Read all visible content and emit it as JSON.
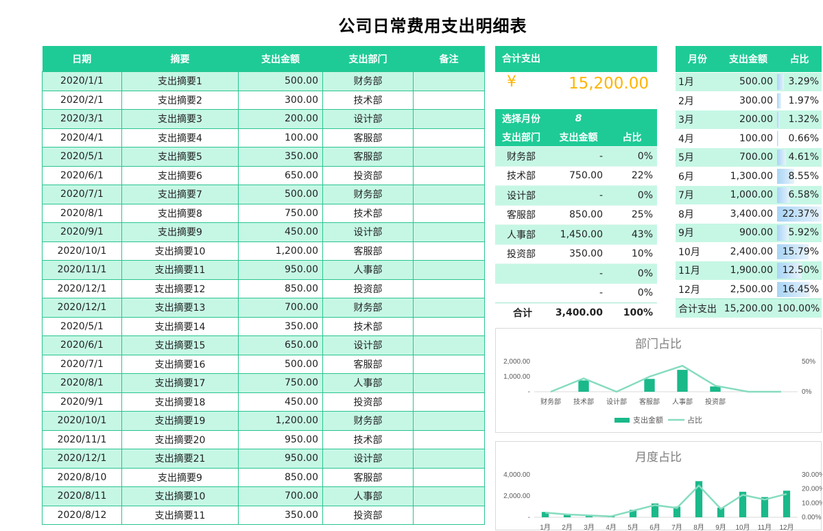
{
  "title": "公司日常费用支出明细表",
  "colors": {
    "accent": "#1ecb96",
    "stripe": "#c6f7e5",
    "total": "#ffb400"
  },
  "main_table": {
    "headers": [
      "日期",
      "摘要",
      "支出金额",
      "支出部门",
      "备注"
    ],
    "rows": [
      [
        "2020/1/1",
        "支出摘要1",
        "500.00",
        "财务部",
        ""
      ],
      [
        "2020/2/1",
        "支出摘要2",
        "300.00",
        "技术部",
        ""
      ],
      [
        "2020/3/1",
        "支出摘要3",
        "200.00",
        "设计部",
        ""
      ],
      [
        "2020/4/1",
        "支出摘要4",
        "100.00",
        "客服部",
        ""
      ],
      [
        "2020/5/1",
        "支出摘要5",
        "350.00",
        "客服部",
        ""
      ],
      [
        "2020/6/1",
        "支出摘要6",
        "650.00",
        "投资部",
        ""
      ],
      [
        "2020/7/1",
        "支出摘要7",
        "500.00",
        "财务部",
        ""
      ],
      [
        "2020/8/1",
        "支出摘要8",
        "750.00",
        "技术部",
        ""
      ],
      [
        "2020/9/1",
        "支出摘要9",
        "450.00",
        "设计部",
        ""
      ],
      [
        "2020/10/1",
        "支出摘要10",
        "1,200.00",
        "客服部",
        ""
      ],
      [
        "2020/11/1",
        "支出摘要11",
        "950.00",
        "人事部",
        ""
      ],
      [
        "2020/12/1",
        "支出摘要12",
        "850.00",
        "投资部",
        ""
      ],
      [
        "2020/12/1",
        "支出摘要13",
        "700.00",
        "财务部",
        ""
      ],
      [
        "2020/5/1",
        "支出摘要14",
        "350.00",
        "技术部",
        ""
      ],
      [
        "2020/6/1",
        "支出摘要15",
        "650.00",
        "设计部",
        ""
      ],
      [
        "2020/7/1",
        "支出摘要16",
        "500.00",
        "客服部",
        ""
      ],
      [
        "2020/8/1",
        "支出摘要17",
        "750.00",
        "人事部",
        ""
      ],
      [
        "2020/9/1",
        "支出摘要18",
        "450.00",
        "投资部",
        ""
      ],
      [
        "2020/10/1",
        "支出摘要19",
        "1,200.00",
        "财务部",
        ""
      ],
      [
        "2020/11/1",
        "支出摘要20",
        "950.00",
        "技术部",
        ""
      ],
      [
        "2020/12/1",
        "支出摘要21",
        "950.00",
        "设计部",
        ""
      ],
      [
        "2020/8/10",
        "支出摘要9",
        "850.00",
        "客服部",
        ""
      ],
      [
        "2020/8/11",
        "支出摘要10",
        "700.00",
        "人事部",
        ""
      ],
      [
        "2020/8/12",
        "支出摘要11",
        "350.00",
        "投资部",
        ""
      ]
    ]
  },
  "total": {
    "label": "合计支出",
    "currency": "¥",
    "value": "15,200.00"
  },
  "dept_table": {
    "select_label": "选择月份",
    "selected_month": "8",
    "headers": [
      "支出部门",
      "支出金额",
      "占比"
    ],
    "rows": [
      [
        "财务部",
        "-",
        "0%"
      ],
      [
        "技术部",
        "750.00",
        "22%"
      ],
      [
        "设计部",
        "-",
        "0%"
      ],
      [
        "客服部",
        "850.00",
        "25%"
      ],
      [
        "人事部",
        "1,450.00",
        "43%"
      ],
      [
        "投资部",
        "350.00",
        "10%"
      ],
      [
        "",
        "-",
        "0%"
      ],
      [
        "",
        "-",
        "0%"
      ]
    ],
    "footer": [
      "合计",
      "3,400.00",
      "100%"
    ]
  },
  "monthly_table": {
    "headers": [
      "月份",
      "支出金额",
      "占比"
    ],
    "rows": [
      [
        "1月",
        "500.00",
        "3.29%"
      ],
      [
        "2月",
        "300.00",
        "1.97%"
      ],
      [
        "3月",
        "200.00",
        "1.32%"
      ],
      [
        "4月",
        "100.00",
        "0.66%"
      ],
      [
        "5月",
        "700.00",
        "4.61%"
      ],
      [
        "6月",
        "1,300.00",
        "8.55%"
      ],
      [
        "7月",
        "1,000.00",
        "6.58%"
      ],
      [
        "8月",
        "3,400.00",
        "22.37%"
      ],
      [
        "9月",
        "900.00",
        "5.92%"
      ],
      [
        "10月",
        "2,400.00",
        "15.79%"
      ],
      [
        "11月",
        "1,900.00",
        "12.50%"
      ],
      [
        "12月",
        "2,500.00",
        "16.45%"
      ]
    ],
    "bar_fractions": [
      0.0329,
      0.0197,
      0.0132,
      0.0066,
      0.0461,
      0.0855,
      0.0658,
      0.2237,
      0.0592,
      0.1579,
      0.125,
      0.1645
    ],
    "footer": [
      "合计支出",
      "15,200.00",
      "100.00%"
    ]
  },
  "chart_data": [
    {
      "type": "bar",
      "title": "部门占比",
      "categories": [
        "财务部",
        "技术部",
        "设计部",
        "客服部",
        "人事部",
        "投资部",
        "",
        ""
      ],
      "series": [
        {
          "name": "支出金额",
          "kind": "bar",
          "values": [
            0,
            750,
            0,
            850,
            1450,
            350,
            0,
            0
          ]
        },
        {
          "name": "占比",
          "kind": "line",
          "axis": "right",
          "values": [
            0,
            22,
            0,
            25,
            43,
            10,
            0,
            0
          ]
        }
      ],
      "y_ticks": [
        "-",
        "1,000.00",
        "2,000.00"
      ],
      "ylim": [
        0,
        2000
      ],
      "y2_ticks": [
        "0%",
        "50%"
      ],
      "y2lim": [
        0,
        50
      ],
      "legend": "bottom"
    },
    {
      "type": "bar",
      "title": "月度占比",
      "categories": [
        "1月",
        "2月",
        "3月",
        "4月",
        "5月",
        "6月",
        "7月",
        "8月",
        "9月",
        "10月",
        "11月",
        "12月"
      ],
      "series": [
        {
          "name": "支出金额",
          "kind": "bar",
          "values": [
            500,
            300,
            200,
            100,
            700,
            1300,
            1000,
            3400,
            900,
            2400,
            1900,
            2500
          ]
        },
        {
          "name": "占比",
          "kind": "line",
          "axis": "right",
          "values": [
            3.29,
            1.97,
            1.32,
            0.66,
            4.61,
            8.55,
            6.58,
            22.37,
            5.92,
            15.79,
            12.5,
            16.45
          ]
        }
      ],
      "y_ticks": [
        "-",
        "2,000.00",
        "4,000.00"
      ],
      "ylim": [
        0,
        4000
      ],
      "y2_ticks": [
        "0.00%",
        "10.00%",
        "20.00%",
        "30.00%"
      ],
      "y2lim": [
        0,
        30
      ]
    }
  ]
}
